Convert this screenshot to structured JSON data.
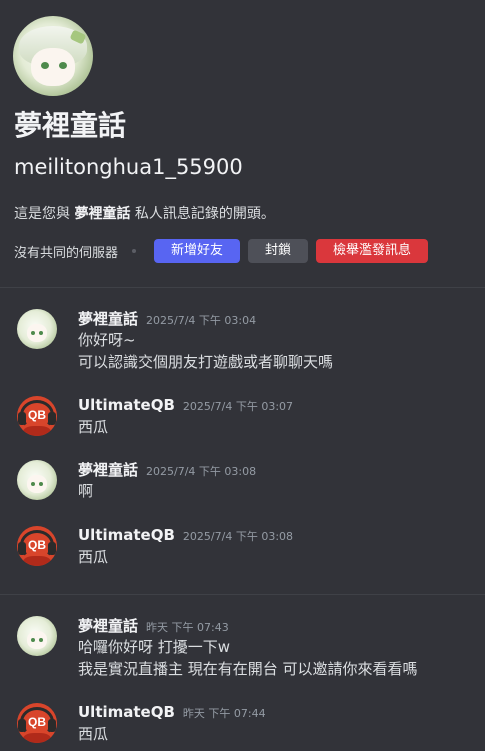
{
  "profile": {
    "display_name": "夢裡童話",
    "username": "meilitonghua1_55900",
    "intro_prefix": "這是您與 ",
    "intro_name": "夢裡童話",
    "intro_suffix": " 私人訊息記錄的開頭。",
    "mutual_servers": "沒有共同的伺服器"
  },
  "actions": {
    "add_friend": "新增好友",
    "block": "封鎖",
    "report_spam": "檢舉濫發訊息"
  },
  "colors": {
    "background": "#323339",
    "add_friend": "#5865f2",
    "block": "#4e5058",
    "report": "#da373c"
  },
  "messages": [
    {
      "author": "夢裡童話",
      "time": "2025/7/4 下午 03:04",
      "lines": [
        "你好呀~",
        "可以認識交個朋友打遊戲或者聊聊天嗎"
      ]
    },
    {
      "author": "UltimateQB",
      "time": "2025/7/4 下午 03:07",
      "lines": [
        "西瓜"
      ]
    },
    {
      "author": "夢裡童話",
      "time": "2025/7/4 下午 03:08",
      "lines": [
        "啊"
      ]
    },
    {
      "author": "UltimateQB",
      "time": "2025/7/4 下午 03:08",
      "lines": [
        "西瓜"
      ]
    },
    {
      "author": "夢裡童話",
      "time": "昨天 下午 07:43",
      "lines": [
        "哈囉你好呀 打擾一下w",
        "我是實況直播主  現在有在開台 可以邀請你來看看嗎"
      ]
    },
    {
      "author": "UltimateQB",
      "time": "昨天 下午 07:44",
      "lines": [
        "西瓜"
      ]
    }
  ]
}
